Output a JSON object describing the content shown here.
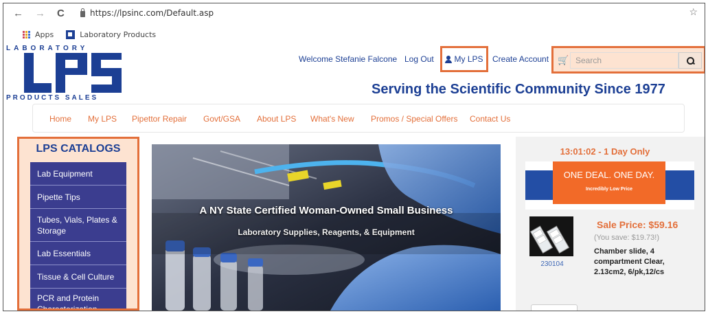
{
  "browser": {
    "url": "https://lpsinc.com/Default.asp",
    "bookmarks": [
      {
        "label": "Apps"
      },
      {
        "label": "Laboratory Products"
      }
    ]
  },
  "logo": {
    "top_text": "LABORATORY",
    "mark_text": "LPS",
    "bottom_text": "PRODUCTS SALES"
  },
  "header": {
    "welcome": "Welcome Stefanie Falcone",
    "logout": "Log Out",
    "my_lps": "My LPS",
    "create_account": "Create Account",
    "search_placeholder": "Search",
    "tagline": "Serving the Scientific Community Since 1977"
  },
  "nav": [
    "Home",
    "My LPS",
    "Pipettor Repair",
    "Govt/GSA",
    "About LPS",
    "What's New",
    "Promos / Special Offers",
    "Contact Us"
  ],
  "sidebar": {
    "title": "LPS CATALOGS",
    "items": [
      {
        "label": "Lab Equipment"
      },
      {
        "label": "Pipette Tips"
      },
      {
        "label": "Tubes, Vials, Plates & Storage"
      },
      {
        "label": "Lab Essentials"
      },
      {
        "label": "Tissue & Cell Culture"
      },
      {
        "label": "PCR and Protein Characterization"
      }
    ]
  },
  "hero": {
    "title": "A NY State Certified Woman-Owned Small Business",
    "subtitle": "Laboratory Supplies, Reagents, & Equipment"
  },
  "deal": {
    "timer": "13:01:02 - 1 Day Only",
    "banner_main": "ONE DEAL. ONE DAY.",
    "banner_small": "Incredibly Low Price",
    "sale_price": "Sale Price:  $59.16",
    "you_save": "(You save: $19.73!)",
    "product_sku": "230104",
    "product_desc": "Chamber slide, 4 compartment Clear, 2.13cm2, 6/pk,12/cs"
  },
  "colors": {
    "brand_blue": "#1c3f94",
    "accent_orange": "#e36f3a",
    "highlight_fill": "#fde3d1",
    "catalog_purple": "#3b3d8f"
  },
  "icons": [
    "back-arrow-icon",
    "forward-arrow-icon",
    "reload-icon",
    "lock-icon",
    "bookmark-star-icon",
    "apps-grid-icon",
    "person-icon",
    "cart-icon",
    "search-icon"
  ]
}
